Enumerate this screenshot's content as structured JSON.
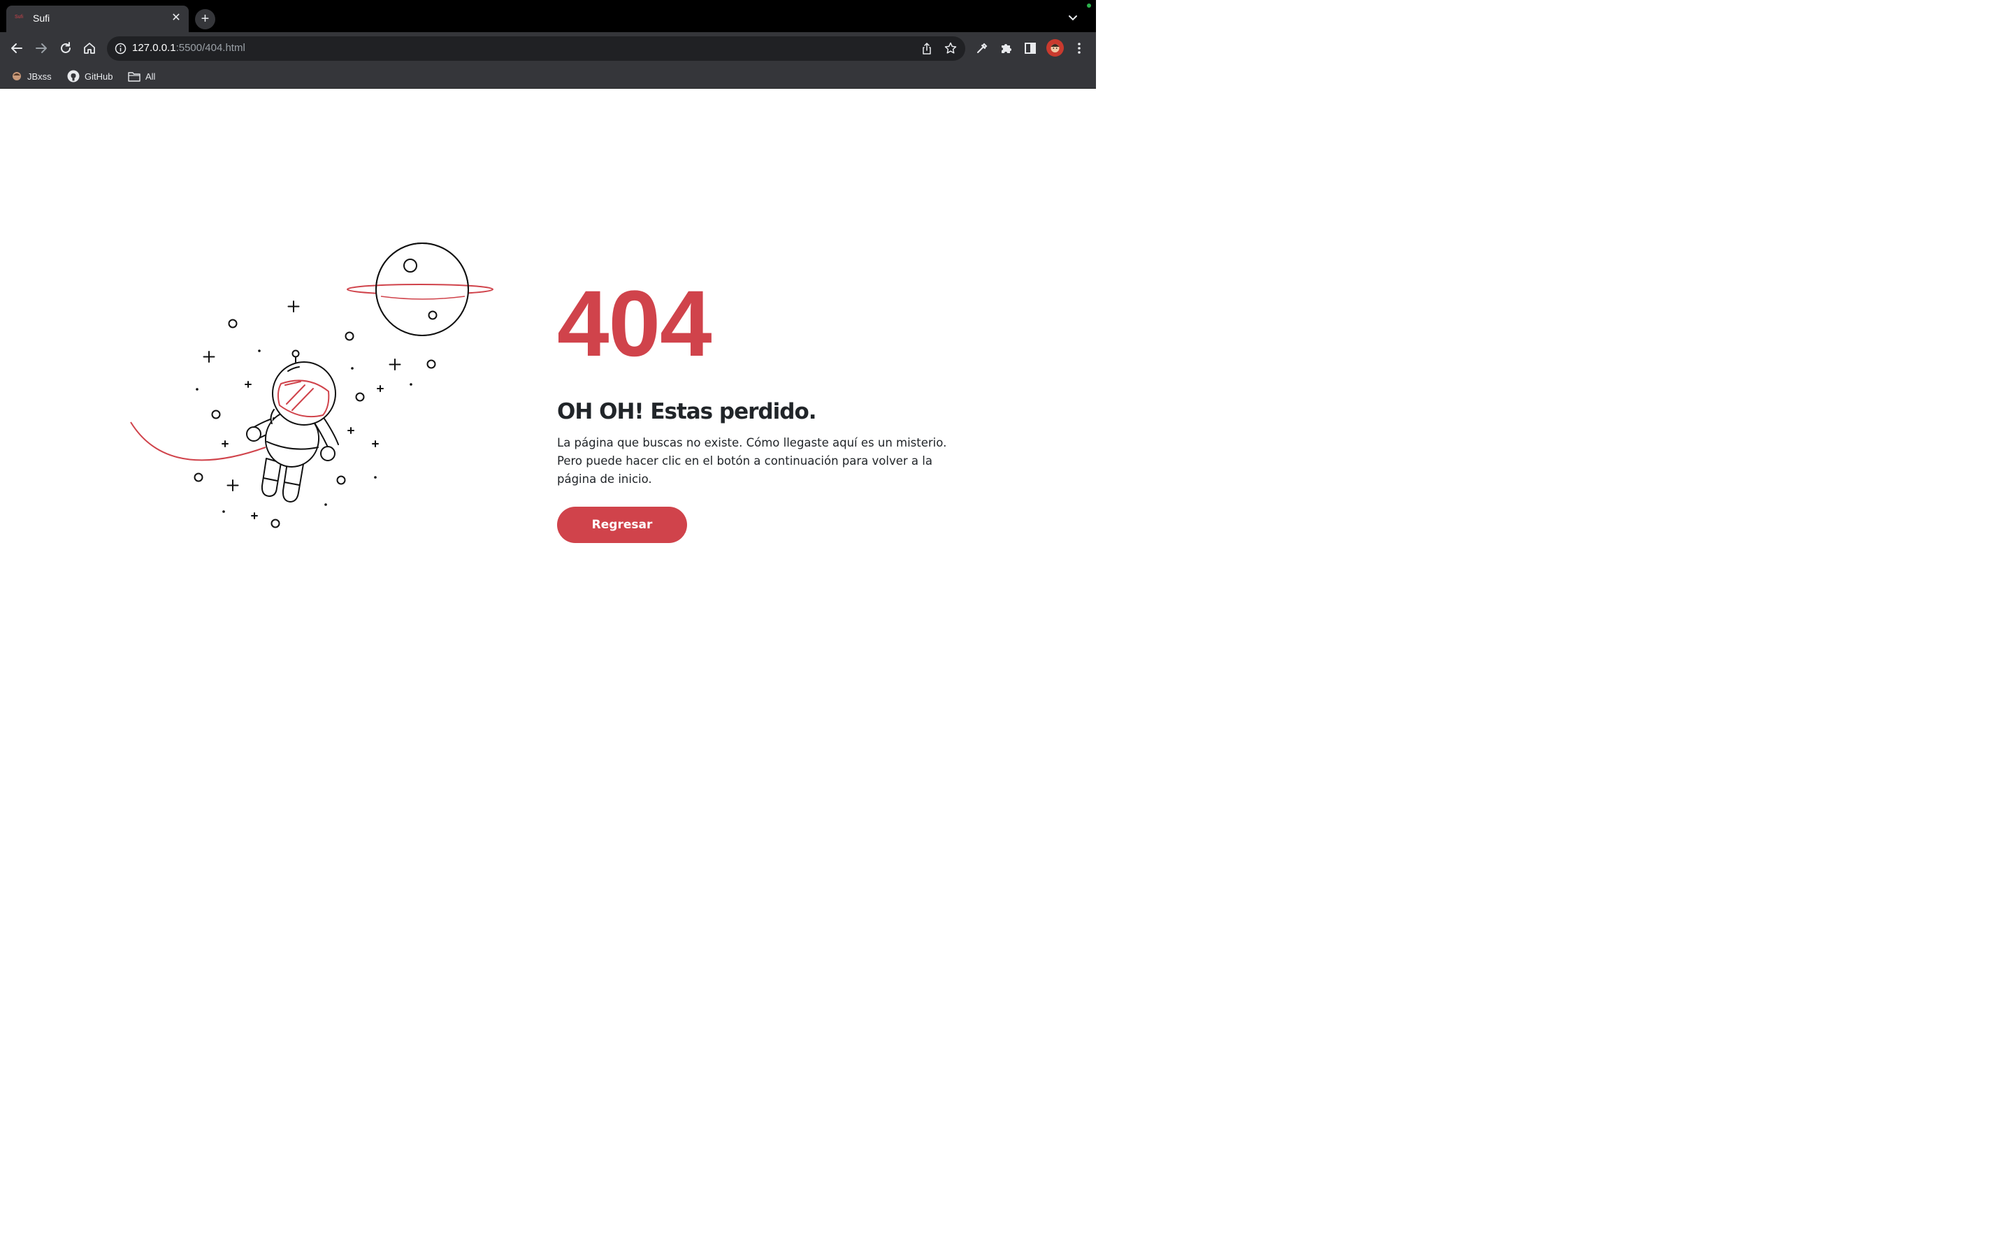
{
  "browser": {
    "tab": {
      "title": "Sufi",
      "favicon_text": "Sufi"
    },
    "new_tab_label": "+",
    "address": {
      "host": "127.0.0.1",
      "path": ":5500/404.html"
    },
    "bookmarks": [
      {
        "label": "JBxss",
        "icon": "avatar-icon"
      },
      {
        "label": "GitHub",
        "icon": "github-icon"
      },
      {
        "label": "All",
        "icon": "folder-icon"
      }
    ]
  },
  "error_page": {
    "code": "404",
    "heading": "OH OH! Estas perdido.",
    "description": "La página que buscas no existe. Cómo llegaste aquí es un misterio. Pero puede hacer clic en el botón a continuación para volver a la página de inicio.",
    "button_label": "Regresar"
  },
  "colors": {
    "accent": "#d0434b",
    "text": "#212529",
    "chrome_dark": "#35363a",
    "tabstrip": "#000000"
  }
}
